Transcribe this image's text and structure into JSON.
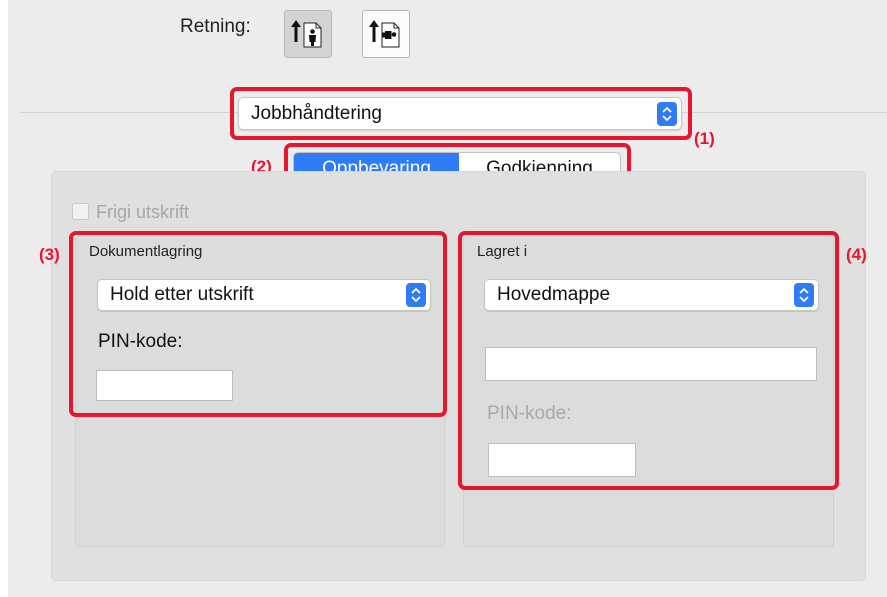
{
  "orientation": {
    "label": "Retning:",
    "buttons": [
      {
        "name": "portrait",
        "selected": true
      },
      {
        "name": "landscape",
        "selected": false
      }
    ]
  },
  "job_handling": {
    "select_value": "Jobbhåndtering",
    "callout": "(1)"
  },
  "tabs": {
    "callout": "(2)",
    "items": [
      "Oppbevaring",
      "Godkjenning"
    ],
    "active": "Oppbevaring"
  },
  "release_print": {
    "label": "Frigi utskrift",
    "checked": false,
    "enabled": false
  },
  "document_storage": {
    "callout": "(3)",
    "title": "Dokumentlagring",
    "mode_value": "Hold etter utskrift",
    "pin_label": "PIN-kode:",
    "pin_value": ""
  },
  "stored_in": {
    "callout": "(4)",
    "title": "Lagret i",
    "folder_value": "Hovedmappe",
    "folder_name_value": "",
    "pin_label": "PIN-kode:",
    "pin_value": ""
  },
  "colors": {
    "accent": "#2f7cf6",
    "highlight": "#e8152f",
    "panel": "#e0e0e0"
  }
}
